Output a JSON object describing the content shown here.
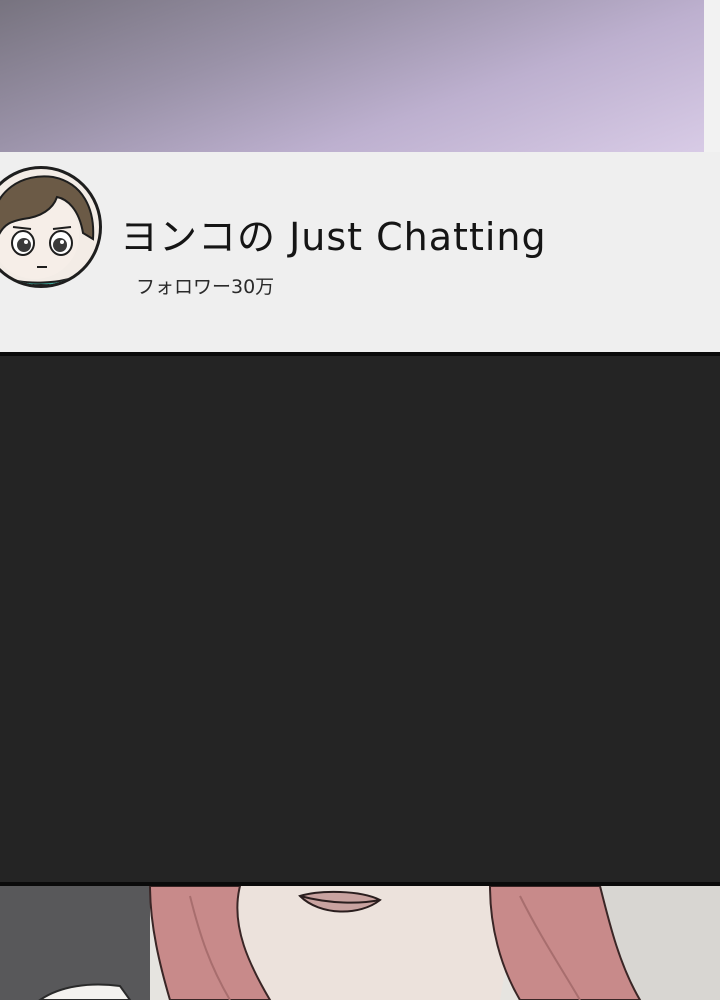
{
  "channel": {
    "title": "ヨンコの Just Chatting",
    "followers": "フォロワー30万"
  },
  "colors": {
    "preview_gradient_start": "#77737f",
    "preview_gradient_end": "#d8cbe6",
    "card_background": "#efefef",
    "dark_panel": "#242424",
    "hair_pink": "#c88a8a",
    "avatar_hair": "#6b5a46",
    "avatar_collar": "#3aa99a"
  },
  "icons": {
    "avatar": "streamer-avatar-icon"
  }
}
